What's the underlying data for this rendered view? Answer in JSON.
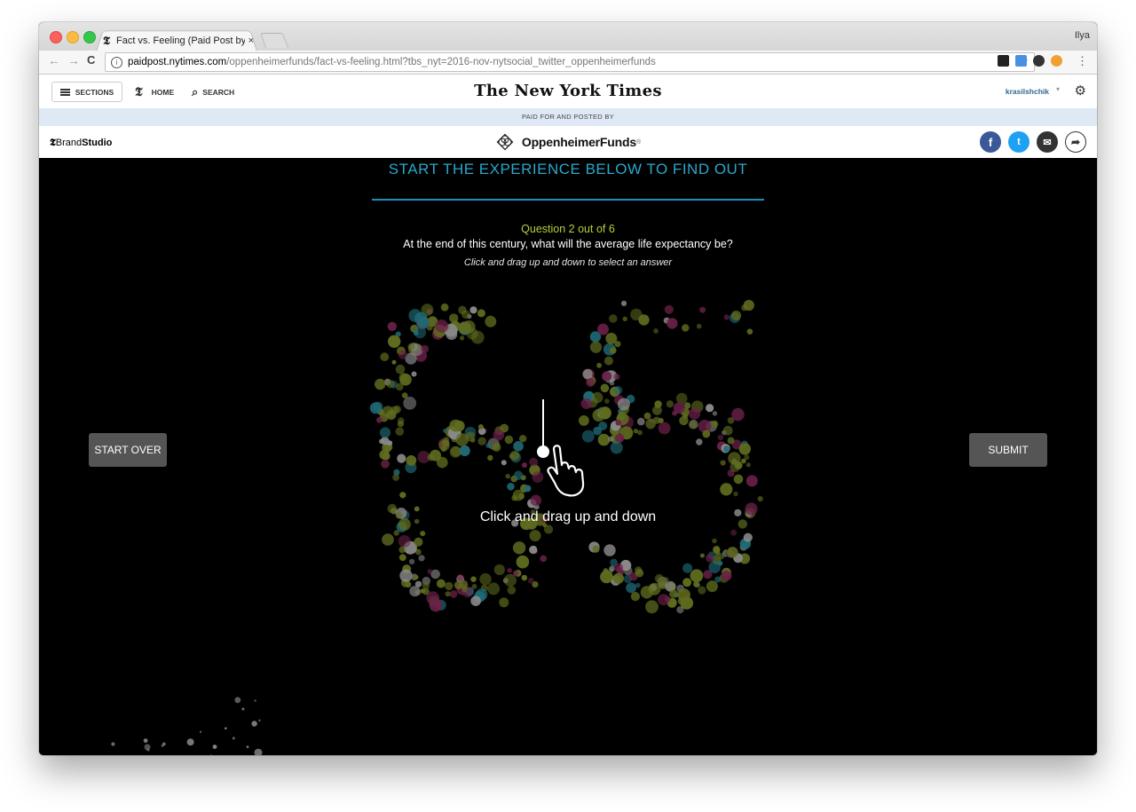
{
  "browser": {
    "tab_title": "Fact vs. Feeling (Paid Post by",
    "tab_close": "×",
    "profile_name": "Ilya",
    "url_host": "paidpost.nytimes.com",
    "url_path": "/oppenheimerfunds/fact-vs-feeling.html?tbs_nyt=2016-nov-nytsocial_twitter_oppenheimerfunds",
    "back": "←",
    "forward": "→",
    "reload": "C",
    "star": "☆",
    "menu": "⋮"
  },
  "nyt_header": {
    "sections_label": "SECTIONS",
    "home_label": "HOME",
    "search_label": "SEARCH",
    "wordmark": "The New York Times",
    "user_name": "krasilshchik",
    "user_caret": "▾",
    "t_logo": "𝕿",
    "gear": "⚙"
  },
  "paid_banner": "PAID FOR AND POSTED BY",
  "brand": {
    "brandstudio_prefix": "Brand",
    "brandstudio_bold": "Studio",
    "oppenheimer": "OppenheimerFunds",
    "reg_mark": "®",
    "share": {
      "facebook": "f",
      "twitter": "t",
      "mail": "✉",
      "more": "➦"
    }
  },
  "stage": {
    "headline": "START THE EXPERIENCE BELOW TO FIND OUT",
    "question_count": "Question 2 out of 6",
    "question": "At the end of this century, what will the average life expectancy be?",
    "hint": "Click and drag up and down to select an answer",
    "selected_value": "65",
    "drag_label": "Click and drag up and down",
    "start_over": "START OVER",
    "submit": "SUBMIT"
  },
  "colors": {
    "accent_blue": "#2aa7cd",
    "question_yellow": "#b6cf3a",
    "button_gray": "#555555",
    "dot_olive": "#5f6b1e",
    "dot_gray": "#8a8a8a",
    "dot_teal": "#1f6a77",
    "dot_magenta": "#6a2048"
  }
}
